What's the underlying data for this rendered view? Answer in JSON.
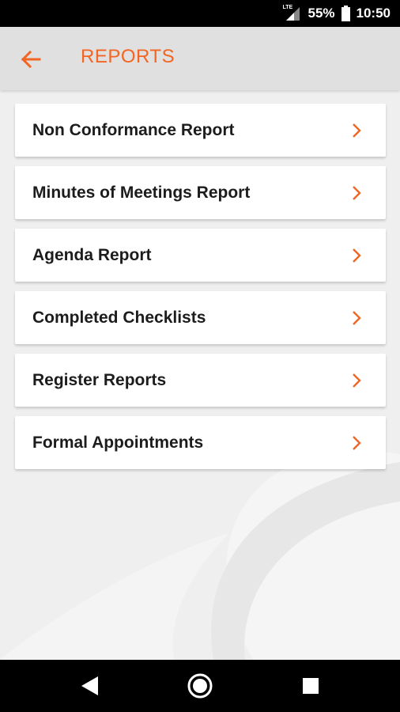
{
  "status_bar": {
    "network": "LTE",
    "battery_percent": "55%",
    "time": "10:50"
  },
  "header": {
    "title": "REPORTS",
    "accent_color": "#f26522"
  },
  "reports": [
    {
      "label": "Non Conformance Report"
    },
    {
      "label": "Minutes of Meetings Report"
    },
    {
      "label": "Agenda Report"
    },
    {
      "label": "Completed Checklists"
    },
    {
      "label": "Register Reports"
    },
    {
      "label": "Formal Appointments"
    }
  ],
  "icons": {
    "back": "arrow-left-icon",
    "chevron": "chevron-right-icon",
    "nav_back": "triangle-back-icon",
    "nav_home": "circle-home-icon",
    "nav_recents": "square-recents-icon"
  }
}
